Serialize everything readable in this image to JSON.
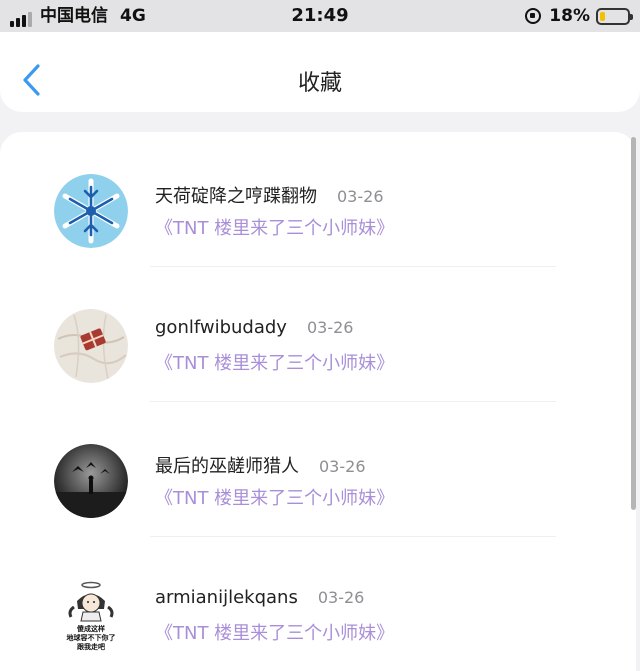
{
  "status_bar": {
    "carrier": "中国电信",
    "network": "4G",
    "time": "21:49",
    "battery_percent": "18%",
    "battery_level": 0.18,
    "battery_color": "#f2c200"
  },
  "nav": {
    "title": "收藏",
    "back_icon": "chevron-left-icon",
    "accent": "#3a9af0"
  },
  "favorites": [
    {
      "username": "天荷碇降之哼蹀翻物",
      "date": "03-26",
      "post_title": "《TNT 楼里来了三个小师妹》",
      "avatar": "snowflake-avatar"
    },
    {
      "username": "gonlfwibudady",
      "date": "03-26",
      "post_title": "《TNT 楼里来了三个小师妹》",
      "avatar": "map-gift-avatar"
    },
    {
      "username": "最后的巫鹾师猎人",
      "date": "03-26",
      "post_title": "《TNT 楼里来了三个小师妹》",
      "avatar": "dark-room-avatar"
    },
    {
      "username": "armianijlekqans",
      "date": "03-26",
      "post_title": "《TNT 楼里来了三个小师妹》",
      "avatar": "angel-girl-meme-avatar",
      "avatar_text": [
        "傻成这样",
        "地球容不下你了",
        "跟我走吧"
      ]
    }
  ],
  "colors": {
    "post_title": "#a98fd9",
    "date": "#8e8e93",
    "username": "#222222"
  }
}
